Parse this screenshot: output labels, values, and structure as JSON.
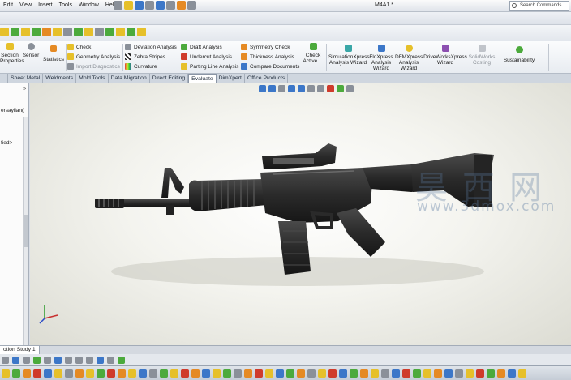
{
  "menu": [
    "Edit",
    "View",
    "Insert",
    "Tools",
    "Window",
    "Help"
  ],
  "document_title": "M4A1 *",
  "search": {
    "placeholder": "Search Commands"
  },
  "command_manager": {
    "section_properties": "Section\nProperties",
    "sensor": "Sensor",
    "statistics": "Statistics",
    "check": "Check",
    "geometry_analysis": "Geometry Analysis",
    "import_diagnostics": "Import Diagnostics",
    "deviation_analysis": "Deviation Analysis",
    "zebra_stripes": "Zebra Stripes",
    "curvature": "Curvature",
    "draft_analysis": "Draft Analysis",
    "undercut_analysis": "Undercut Analysis",
    "parting_line_analysis": "Parting Line Analysis",
    "symmetry_check": "Symmetry Check",
    "thickness_analysis": "Thickness Analysis",
    "compare_documents": "Compare Documents",
    "check_active": "Check\nActive ...",
    "simulationxpress": "SimulationXpress\nAnalysis Wizard",
    "floxpress": "FloXpress\nAnalysis\nWizard",
    "dfmxpress": "DFMXpress\nAnalysis\nWizard",
    "driveworksxpress": "DriveWorksXpress\nWizard",
    "solidworks_costing": "SolidWorks\nCosting",
    "sustainability": "Sustainability"
  },
  "tabs": [
    "Sheet Metal",
    "Weldments",
    "Mold Tools",
    "Data Migration",
    "Direct Editing",
    "Evaluate",
    "DimXpert",
    "Office Products"
  ],
  "active_tab": "Evaluate",
  "tree": {
    "row1": "ersayilan(",
    "row2": "fied>"
  },
  "watermark": {
    "chars": "昊西网",
    "url": "www.3dmox.com"
  },
  "bottom_tab": "otion Study 1",
  "colors": {
    "accent": "#3c77c8",
    "viewport_bg": "#f4f4ef",
    "model": "#2b2b2b"
  },
  "icons": [
    "save-icon",
    "print-icon",
    "undo-icon",
    "select-icon",
    "rebuild-icon",
    "options-icon",
    "search-icon",
    "zoom-icon",
    "view-orientation-icon"
  ]
}
